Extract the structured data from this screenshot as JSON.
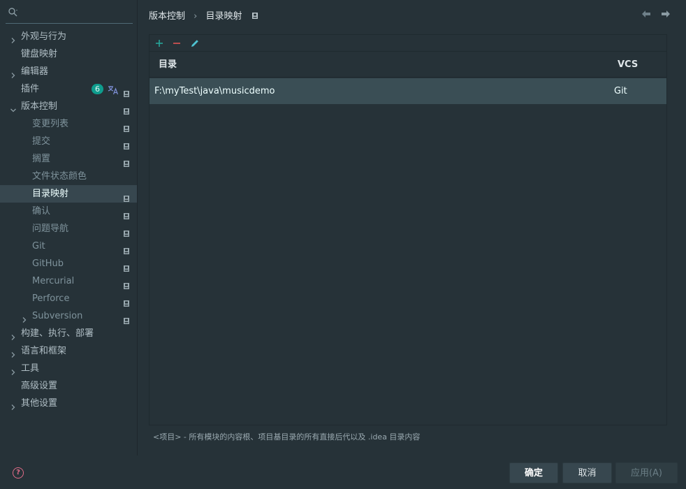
{
  "sidebar": {
    "search": {
      "placeholder": ""
    },
    "items": [
      {
        "label": "外观与行为",
        "level": 0,
        "expandable": true,
        "expanded": false,
        "project": false
      },
      {
        "label": "键盘映射",
        "level": 0,
        "expandable": false,
        "project": false
      },
      {
        "label": "编辑器",
        "level": 0,
        "expandable": true,
        "expanded": false,
        "project": false
      },
      {
        "label": "插件",
        "level": 0,
        "expandable": false,
        "project": true,
        "badge": "6",
        "translate": true
      },
      {
        "label": "版本控制",
        "level": 0,
        "expandable": true,
        "expanded": true,
        "project": true
      },
      {
        "label": "变更列表",
        "level": 1,
        "expandable": false,
        "project": true
      },
      {
        "label": "提交",
        "level": 1,
        "expandable": false,
        "project": true
      },
      {
        "label": "搁置",
        "level": 1,
        "expandable": false,
        "project": true
      },
      {
        "label": "文件状态颜色",
        "level": 1,
        "expandable": false,
        "project": false
      },
      {
        "label": "目录映射",
        "level": 1,
        "expandable": false,
        "project": true,
        "selected": true
      },
      {
        "label": "确认",
        "level": 1,
        "expandable": false,
        "project": true
      },
      {
        "label": "问题导航",
        "level": 1,
        "expandable": false,
        "project": true
      },
      {
        "label": "Git",
        "level": 1,
        "expandable": false,
        "project": true
      },
      {
        "label": "GitHub",
        "level": 1,
        "expandable": false,
        "project": true
      },
      {
        "label": "Mercurial",
        "level": 1,
        "expandable": false,
        "project": true
      },
      {
        "label": "Perforce",
        "level": 1,
        "expandable": false,
        "project": true
      },
      {
        "label": "Subversion",
        "level": 1,
        "expandable": true,
        "expanded": false,
        "project": true
      },
      {
        "label": "构建、执行、部署",
        "level": 0,
        "expandable": true,
        "expanded": false,
        "project": false
      },
      {
        "label": "语言和框架",
        "level": 0,
        "expandable": true,
        "expanded": false,
        "project": false
      },
      {
        "label": "工具",
        "level": 0,
        "expandable": true,
        "expanded": false,
        "project": false
      },
      {
        "label": "高级设置",
        "level": 0,
        "expandable": false,
        "project": false
      },
      {
        "label": "其他设置",
        "level": 0,
        "expandable": true,
        "expanded": false,
        "project": false
      }
    ]
  },
  "breadcrumb": {
    "parent": "版本控制",
    "current": "目录映射"
  },
  "table": {
    "columns": {
      "directory": "目录",
      "vcs": "VCS"
    },
    "rows": [
      {
        "directory": "F:\\myTest\\java\\musicdemo",
        "vcs": "Git"
      }
    ]
  },
  "footnote": "<项目> - 所有模块的内容根、项目基目录的所有直接后代以及 .idea 目录内容",
  "buttons": {
    "ok": "确定",
    "cancel": "取消",
    "apply": "应用(A)"
  },
  "colors": {
    "accent_add": "#26a69a",
    "accent_remove": "#e05555",
    "accent_edit": "#4fc3d1",
    "selection": "#37474f"
  }
}
